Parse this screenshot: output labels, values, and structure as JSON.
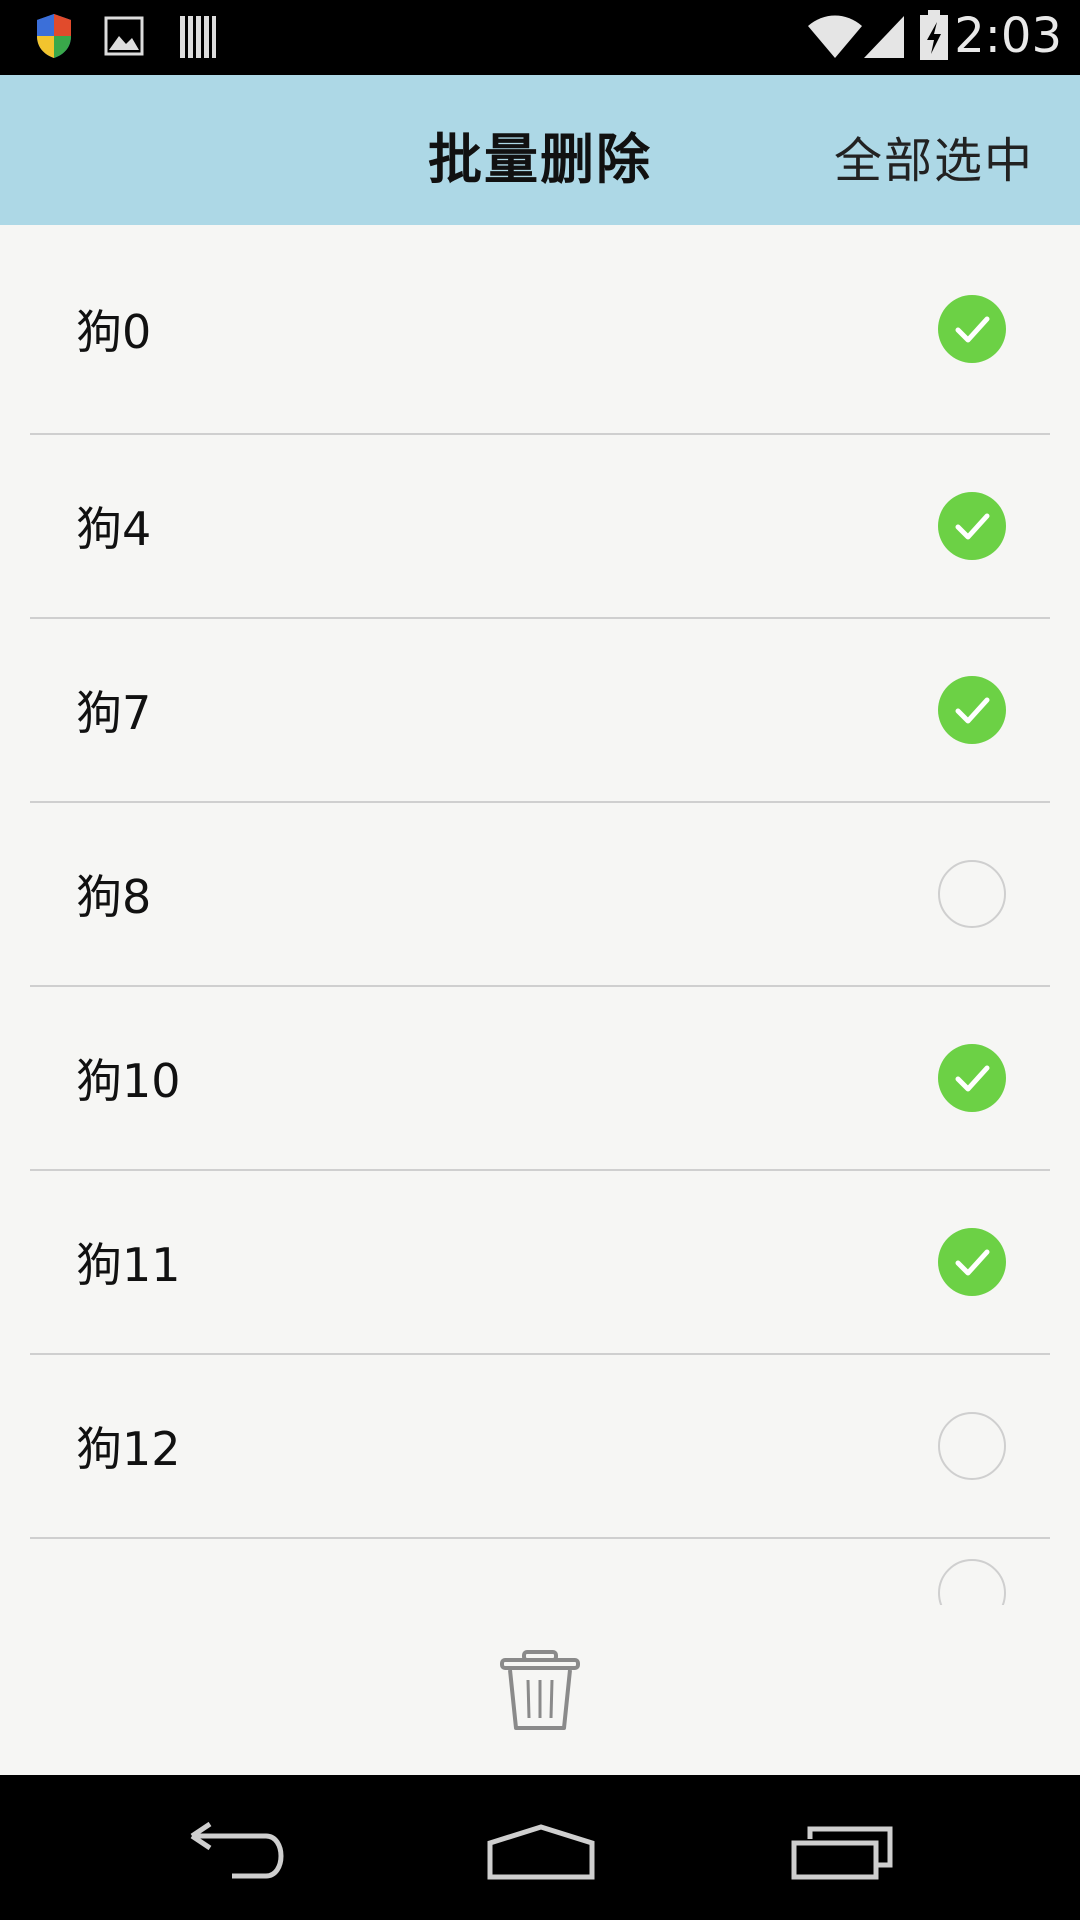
{
  "status_bar": {
    "time": "2:03",
    "icons": [
      "shield-icon",
      "image-icon",
      "barcode-icon",
      "wifi-icon",
      "signal-icon",
      "battery-charging-icon"
    ]
  },
  "app_bar": {
    "title": "批量删除",
    "select_all_label": "全部选中"
  },
  "list": {
    "items": [
      {
        "label": "狗0",
        "checked": true
      },
      {
        "label": "狗4",
        "checked": true
      },
      {
        "label": "狗7",
        "checked": true
      },
      {
        "label": "狗8",
        "checked": false
      },
      {
        "label": "狗10",
        "checked": true
      },
      {
        "label": "狗11",
        "checked": true
      },
      {
        "label": "狗12",
        "checked": false
      }
    ]
  },
  "action_bar": {
    "icon": "trash-icon"
  },
  "nav_bar": {
    "buttons": [
      "back-icon",
      "home-icon",
      "recents-icon"
    ]
  },
  "colors": {
    "app_bar_bg": "#add8e6",
    "checked": "#6cd145",
    "list_bg": "#f6f6f4",
    "divider": "#cfcfcf"
  }
}
